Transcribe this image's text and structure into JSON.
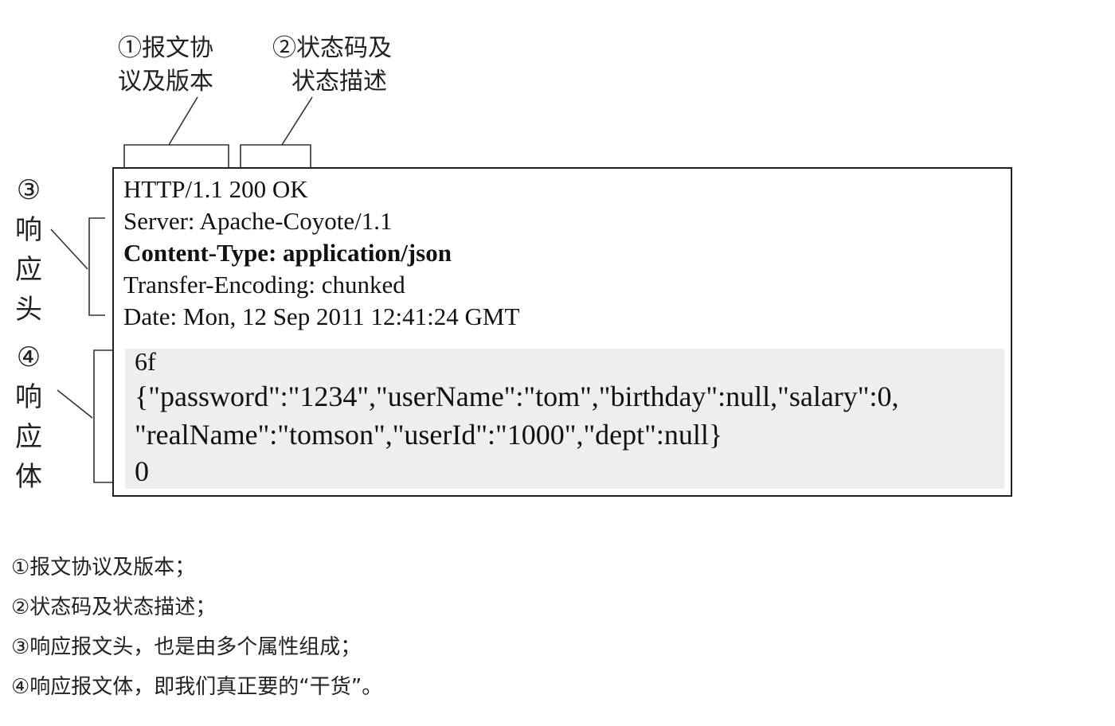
{
  "annotations": {
    "protocol_version": {
      "line1": "①报文协",
      "line2": "议及版本"
    },
    "status_code": {
      "line1": "②状态码及",
      "line2": "状态描述"
    },
    "response_header": {
      "number": "③",
      "chars": "响应头"
    },
    "response_body": {
      "number": "④",
      "chars": "响应体"
    }
  },
  "message": {
    "header_lines": [
      "HTTP/1.1 200 OK",
      "Server: Apache-Coyote/1.1",
      "Content-Type: application/json",
      "Transfer-Encoding: chunked",
      "Date: Mon, 12 Sep 2011 12:41:24 GMT"
    ],
    "body_lines": [
      "6f",
      "{\"password\":\"1234\",\"userName\":\"tom\",\"birthday\":null,\"salary\":0,",
      "\"realName\":\"tomson\",\"userId\":\"1000\",\"dept\":null}",
      "0"
    ]
  },
  "notes": [
    "①报文协议及版本；",
    "②状态码及状态描述；",
    "③响应报文头，也是由多个属性组成；",
    "④响应报文体，即我们真正要的“干货”。"
  ],
  "colors": {
    "stroke": "#222222",
    "body_bg": "#eeeeee",
    "text": "#111111"
  }
}
